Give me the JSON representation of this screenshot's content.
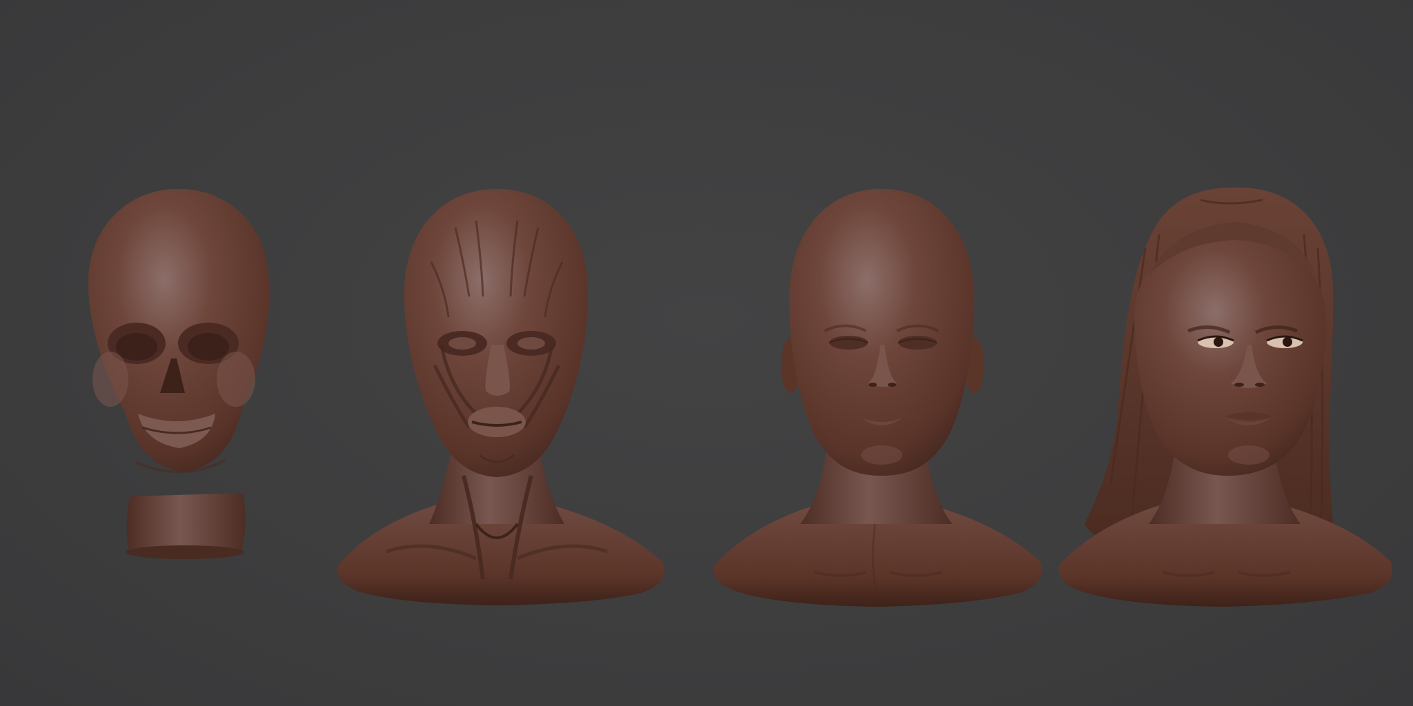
{
  "scene": {
    "background_color": "#3d3d3e",
    "material_color": "#6b4338",
    "material_highlight": "#8a6a64",
    "material_shadow": "#3d2620",
    "models": [
      {
        "stage": "skull",
        "icon": "skull-sculpt"
      },
      {
        "stage": "muscles",
        "icon": "ecorche-sculpt"
      },
      {
        "stage": "skin",
        "icon": "bald-head-sculpt"
      },
      {
        "stage": "hair",
        "icon": "head-with-hair-sculpt"
      }
    ]
  }
}
